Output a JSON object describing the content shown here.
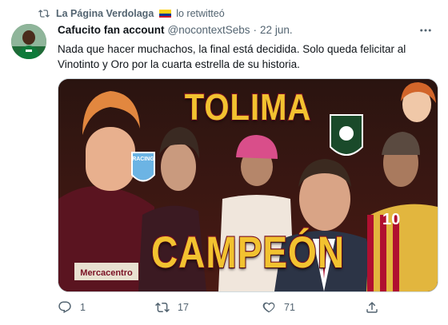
{
  "retweet": {
    "name": "La Página Verdolaga",
    "suffix": "lo retwitteó",
    "icon": "retweet-icon"
  },
  "tweet": {
    "author_name": "Cafucito fan account",
    "handle": "@nocontextSebs",
    "separator": "·",
    "date": "22 jun.",
    "text": "Nada que hacer muchachos, la final está decidida. Solo queda felicitar al Vinotinto y Oro por la cuarta estrella de su historia.",
    "more_icon": "more-icon"
  },
  "media": {
    "title_top": "TOLIMA",
    "title_bottom": "CAMPEÓN",
    "shirt_text": "Mercacentro",
    "jersey_number": "10",
    "badge_text": "RACING",
    "colors": {
      "gold": "#f2c230",
      "wine": "#7a1024"
    }
  },
  "actions": {
    "reply_count": "1",
    "retweet_count": "17",
    "like_count": "71"
  },
  "colors": {
    "muted": "#536471",
    "text": "#0f1419"
  }
}
